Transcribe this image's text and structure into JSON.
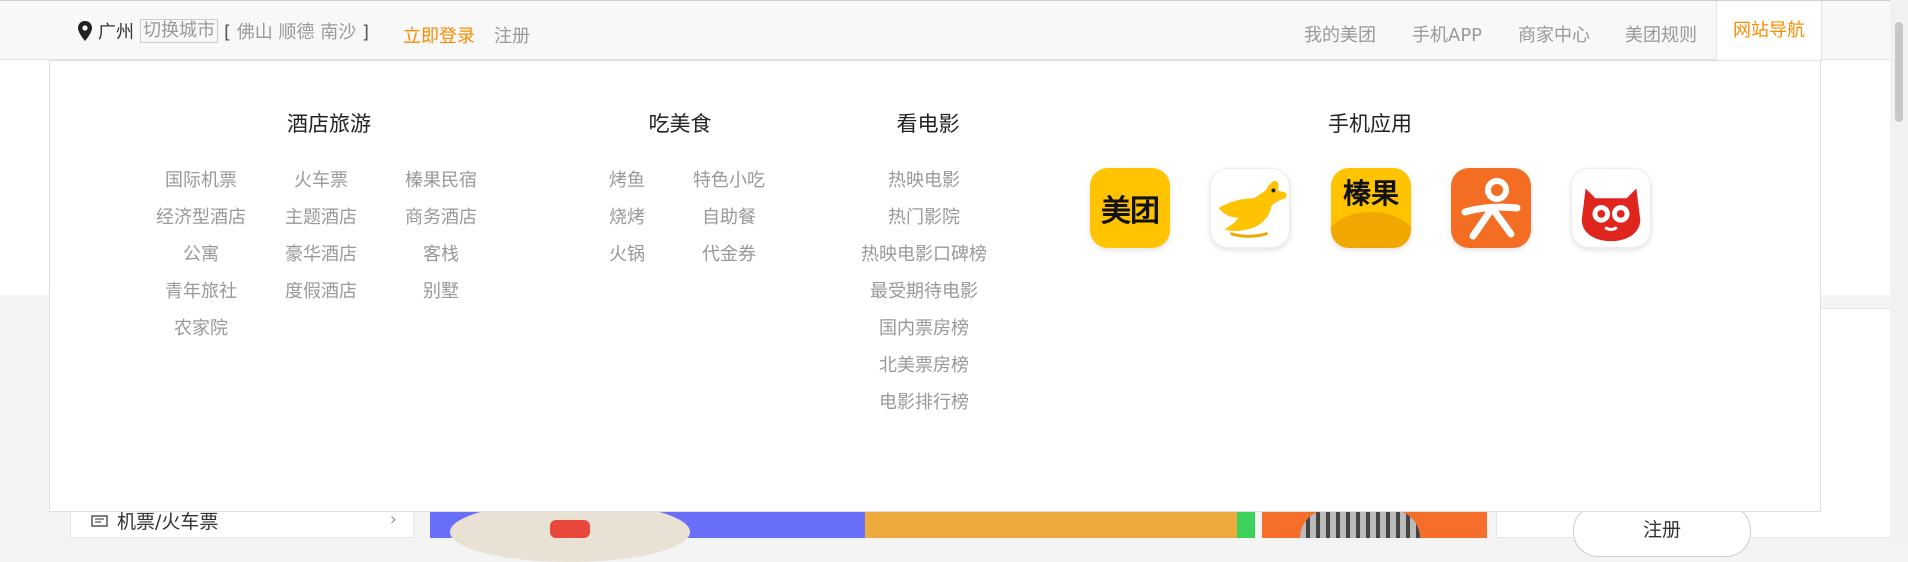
{
  "topbar": {
    "city": "广州",
    "switch_city": "切换城市",
    "nearby_open": "[",
    "nearby_cities": "佛山 顺德 南沙",
    "nearby_close": "]",
    "login": "立即登录",
    "register": "注册",
    "links": [
      "我的美团",
      "手机APP",
      "商家中心",
      "美团规则"
    ],
    "nav_guide": "网站导航"
  },
  "dropdown": {
    "hotel": {
      "title": "酒店旅游",
      "items": [
        "国际机票",
        "火车票",
        "榛果民宿",
        "经济型酒店",
        "主题酒店",
        "商务酒店",
        "公寓",
        "豪华酒店",
        "客栈",
        "青年旅社",
        "度假酒店",
        "别墅",
        "农家院"
      ]
    },
    "food": {
      "title": "吃美食",
      "items": [
        "烤鱼",
        "特色小吃",
        "烧烤",
        "自助餐",
        "火锅",
        "代金券"
      ]
    },
    "movie": {
      "title": "看电影",
      "items": [
        "热映电影",
        "热门影院",
        "热映电影口碑榜",
        "最受期待电影",
        "国内票房榜",
        "北美票房榜",
        "电影排行榜"
      ]
    },
    "apps": {
      "title": "手机应用",
      "meituan_text": "美团",
      "zhenguo_text": "榛果",
      "icons": [
        "meituan-app-icon",
        "meituan-waimai-app-icon",
        "zhenguo-app-icon",
        "dianping-app-icon",
        "maoyan-app-icon"
      ]
    }
  },
  "background": {
    "sidebar_item": "机票/火车票",
    "right_register": "注册"
  },
  "colors": {
    "accent": "#fe8c00",
    "muted": "#999999",
    "meituan_yellow": "#ffc300",
    "dianping_orange": "#f36d22",
    "maoyan_red": "#e0251f"
  }
}
